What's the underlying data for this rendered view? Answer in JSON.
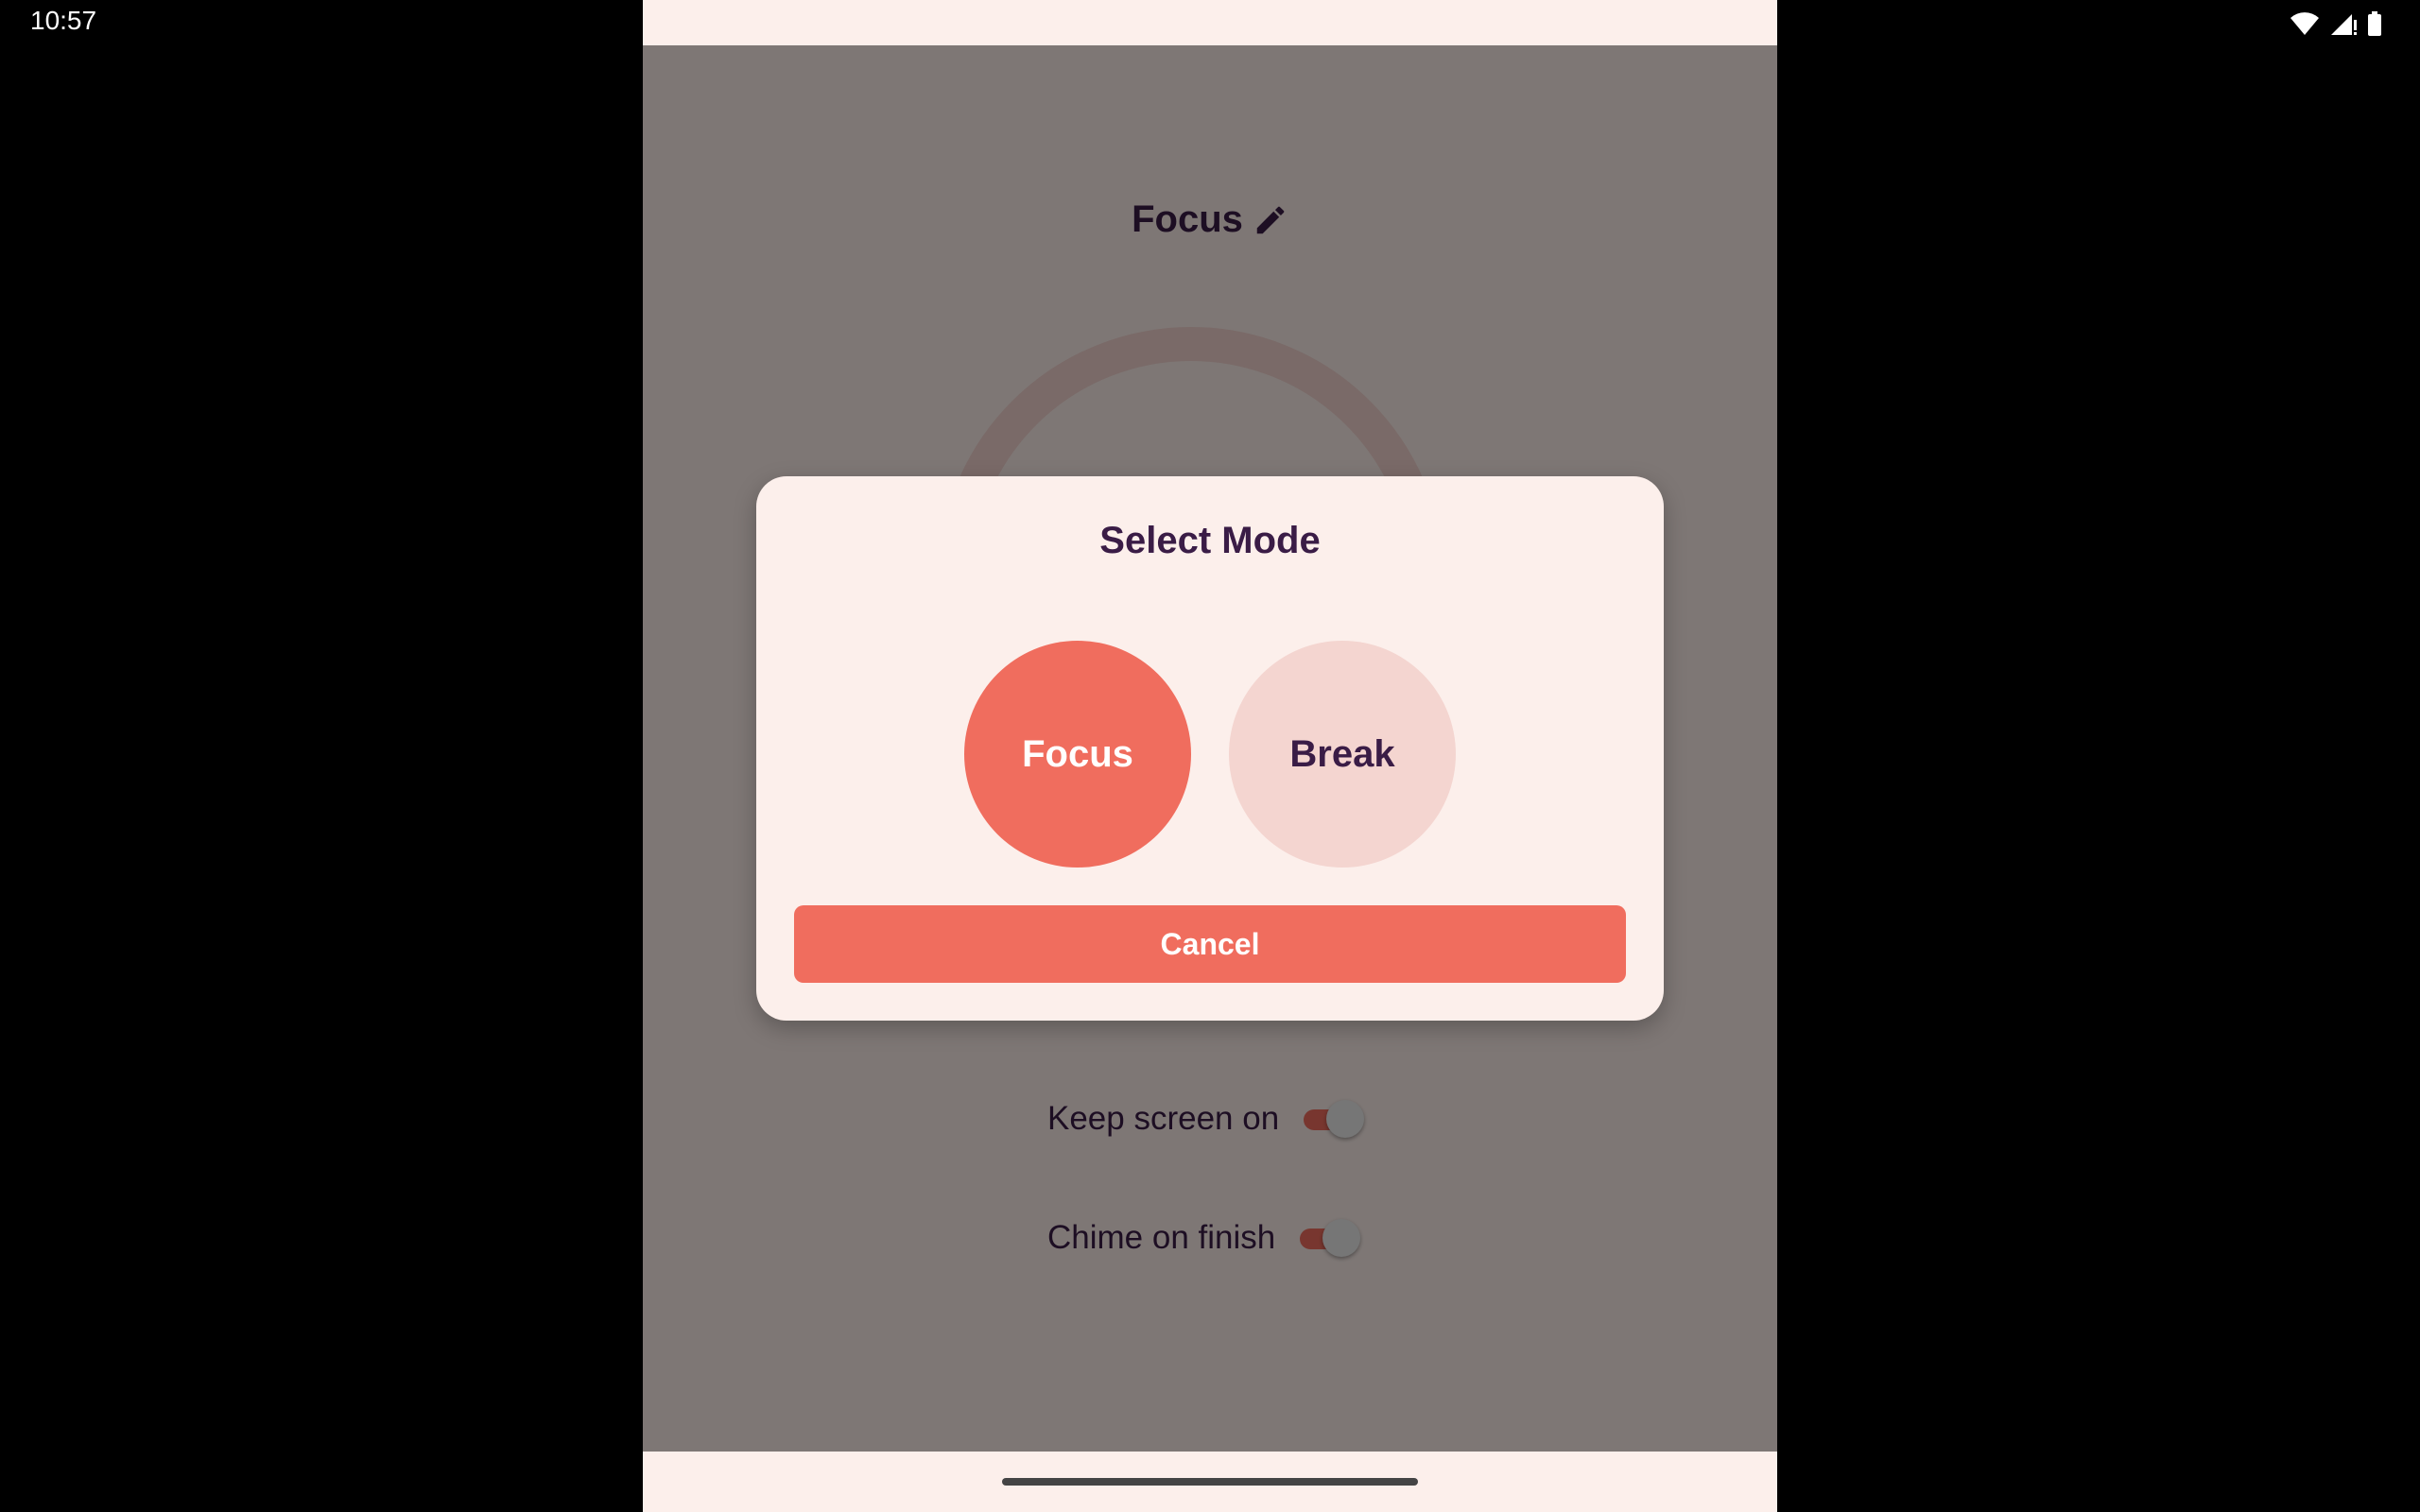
{
  "status_bar": {
    "time": "10:57",
    "icons": [
      "wifi-icon",
      "signal-icon",
      "battery-icon"
    ]
  },
  "app": {
    "mode_title": "Focus",
    "edit_icon": "pencil-icon",
    "settings": [
      {
        "label": "Keep screen on",
        "enabled": true
      },
      {
        "label": "Chime on finish",
        "enabled": true
      }
    ]
  },
  "dialog": {
    "title": "Select Mode",
    "options": [
      {
        "label": "Focus",
        "selected": true
      },
      {
        "label": "Break",
        "selected": false
      }
    ],
    "cancel_label": "Cancel"
  },
  "colors": {
    "accent": "#f06d5e",
    "accent_light": "#f4d5d0",
    "surface": "#fcefeb",
    "text": "#3a1c46",
    "scrim": "rgba(0,0,0,0.5)"
  }
}
